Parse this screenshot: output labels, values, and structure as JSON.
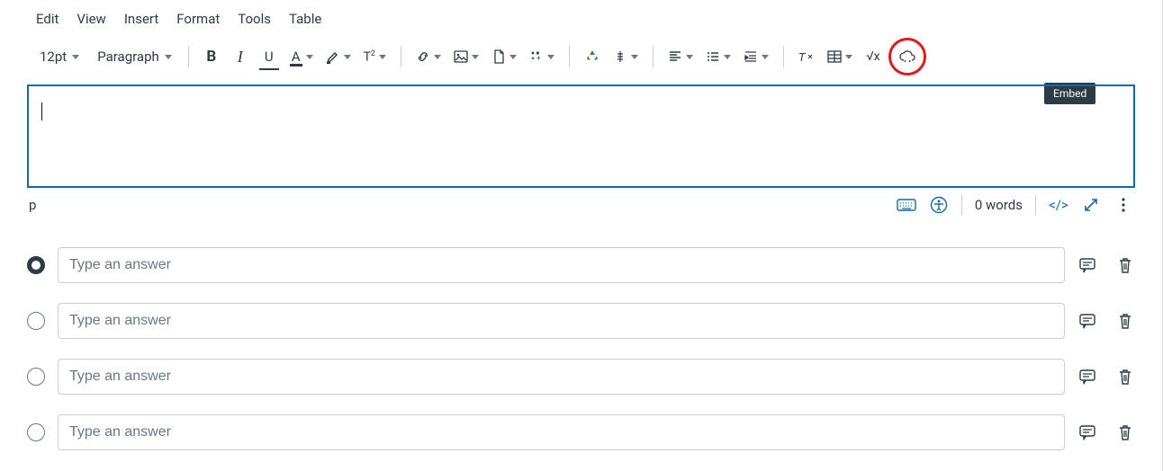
{
  "menubar": {
    "edit": "Edit",
    "view": "View",
    "insert": "Insert",
    "format": "Format",
    "tools": "Tools",
    "table": "Table"
  },
  "toolbar": {
    "font_size": "12pt",
    "block": "Paragraph",
    "embed_tooltip": "Embed"
  },
  "status": {
    "path": "p",
    "word_count": "0 words"
  },
  "answers": {
    "placeholder": "Type an answer",
    "rows": [
      {
        "selected": true
      },
      {
        "selected": false
      },
      {
        "selected": false
      },
      {
        "selected": false
      }
    ]
  }
}
